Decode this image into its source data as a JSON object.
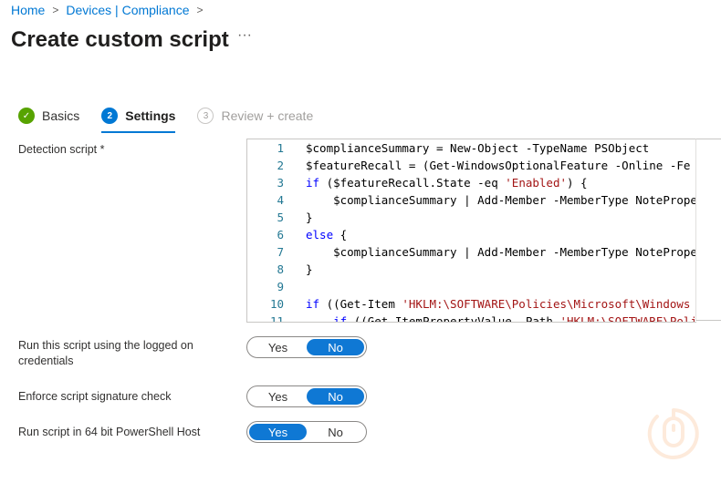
{
  "breadcrumb": [
    "Home",
    "Devices | Compliance"
  ],
  "title": "Create custom script",
  "more": "···",
  "steps": [
    {
      "label": "Basics",
      "state": "done",
      "icon": "check"
    },
    {
      "label": "Settings",
      "state": "current",
      "num": "2"
    },
    {
      "label": "Review + create",
      "state": "future",
      "num": "3"
    }
  ],
  "detection_label": "Detection script *",
  "code": [
    "$complianceSummary = New-Object -TypeName PSObject",
    "$featureRecall = (Get-WindowsOptionalFeature -Online -Fe",
    "if ($featureRecall.State -eq 'Enabled') {",
    "    $complianceSummary | Add-Member -MemberType NotePrope",
    "}",
    "else {",
    "    $complianceSummary | Add-Member -MemberType NotePrope",
    "}",
    "",
    "if ((Get-Item 'HKLM:\\SOFTWARE\\Policies\\Microsoft\\Windows",
    "    if ((Get-ItemPropertyValue -Path 'HKLM:\\SOFTWARE\\Poli"
  ],
  "toggles": [
    {
      "label": "Run this script using the logged on credentials",
      "yes": "Yes",
      "no": "No",
      "value": "No"
    },
    {
      "label": "Enforce script signature check",
      "yes": "Yes",
      "no": "No",
      "value": "No"
    },
    {
      "label": "Run script in 64 bit PowerShell Host",
      "yes": "Yes",
      "no": "No",
      "value": "Yes"
    }
  ],
  "colors": {
    "accent": "#0078d4",
    "done": "#57a300"
  }
}
